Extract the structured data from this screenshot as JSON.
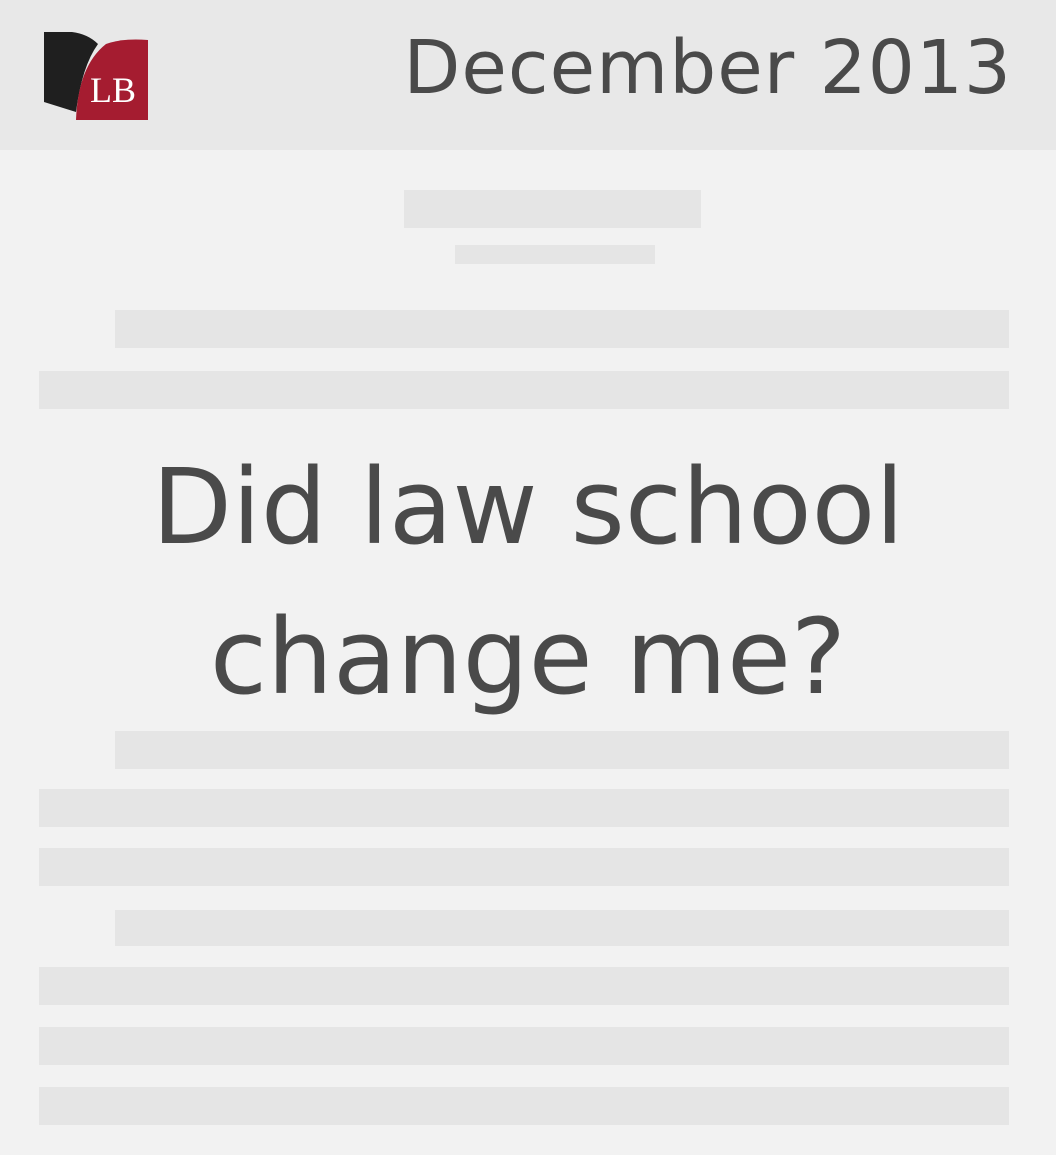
{
  "header": {
    "logo": {
      "text": "LB",
      "colors": {
        "dark": "#1f1f1f",
        "accent": "#a51c30",
        "text": "#ffffff"
      }
    },
    "date": "December 2013"
  },
  "article": {
    "headline_line1": "Did law school",
    "headline_line2": "change me?"
  },
  "colors": {
    "background": "#f2f2f2",
    "header_background": "#e8e8e8",
    "placeholder_bar": "#e5e5e5",
    "text": "#4a4a4a"
  }
}
